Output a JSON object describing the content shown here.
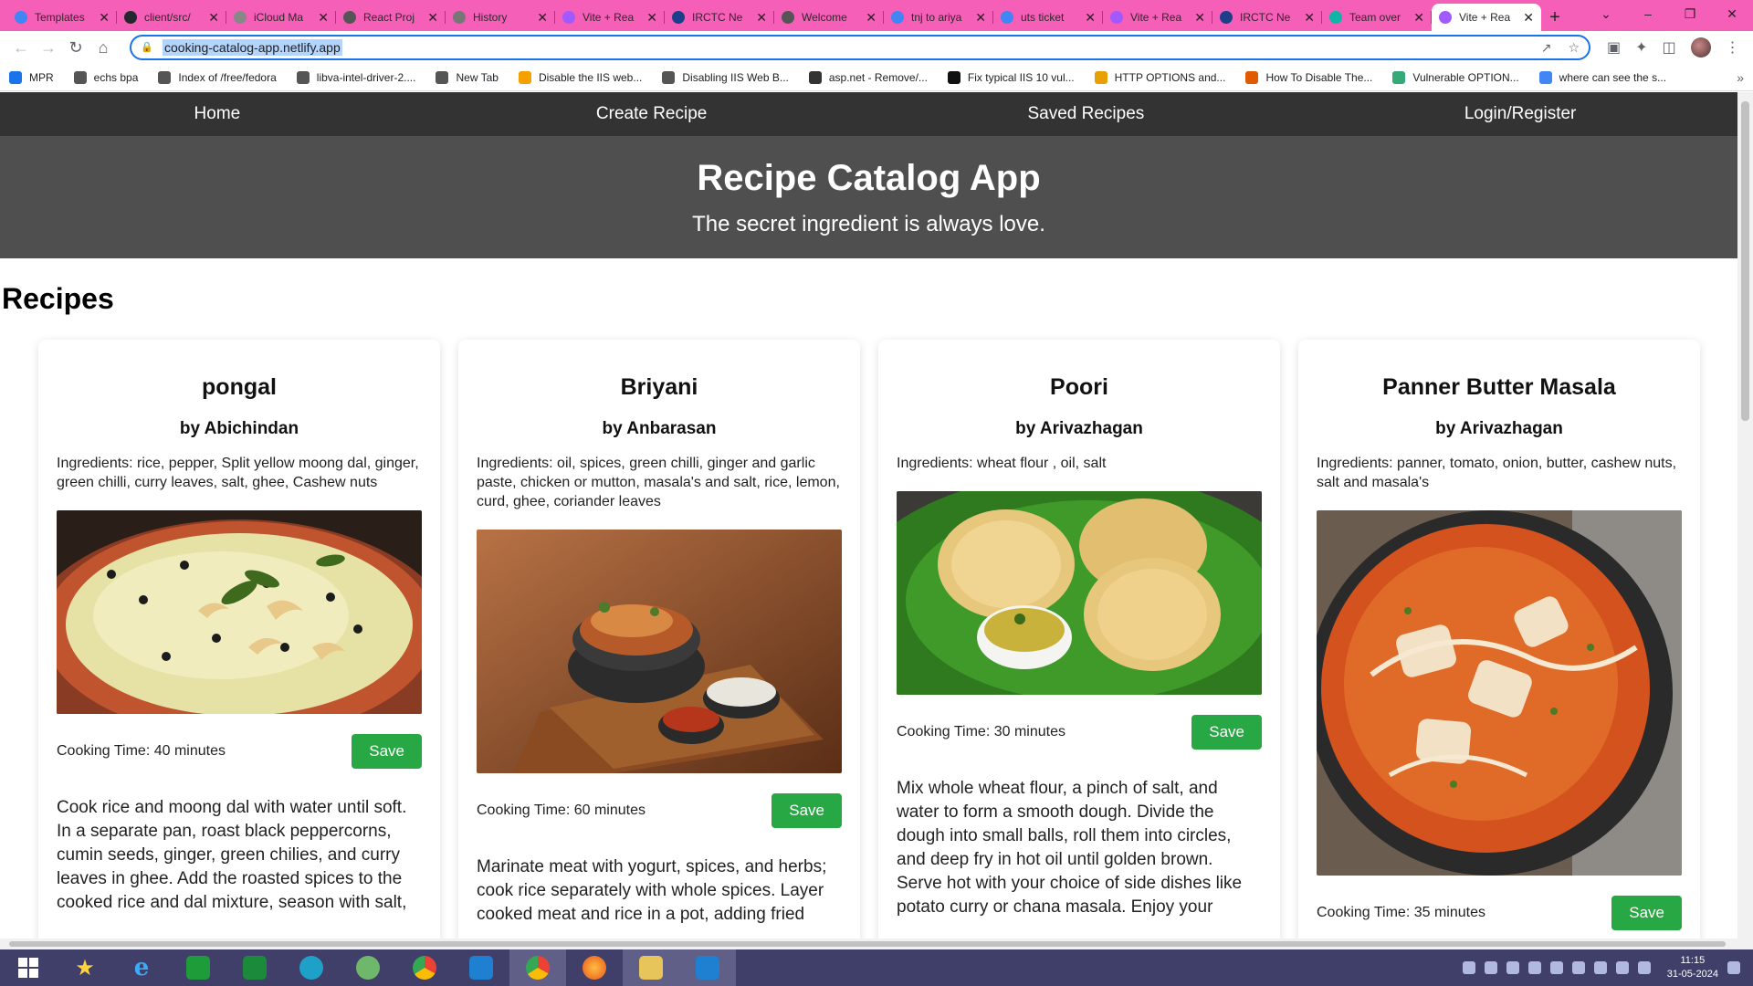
{
  "browser": {
    "tabs": [
      {
        "title": "Templates",
        "color": "#4285f4"
      },
      {
        "title": "client/src/",
        "color": "#24292f"
      },
      {
        "title": "iCloud Ma",
        "color": "#888888"
      },
      {
        "title": "React Proj",
        "color": "#555555"
      },
      {
        "title": "History",
        "color": "#777777"
      },
      {
        "title": "Vite + Rea",
        "color": "#a259ff"
      },
      {
        "title": "IRCTC Ne",
        "color": "#1d3f8a"
      },
      {
        "title": "Welcome",
        "color": "#555555"
      },
      {
        "title": "tnj to ariya",
        "color": "#4285f4"
      },
      {
        "title": "uts ticket",
        "color": "#4285f4"
      },
      {
        "title": "Vite + Rea",
        "color": "#a259ff"
      },
      {
        "title": "IRCTC Ne",
        "color": "#1d3f8a"
      },
      {
        "title": "Team over",
        "color": "#0fb5a6"
      },
      {
        "title": "Vite + Rea",
        "color": "#a259ff",
        "active": true
      }
    ],
    "url": "cooking-catalog-app.netlify.app",
    "bookmarks": [
      {
        "label": "MPR",
        "color": "#1a73e8"
      },
      {
        "label": "echs bpa",
        "color": "#555555"
      },
      {
        "label": "Index of /free/fedora",
        "color": "#555555"
      },
      {
        "label": "libva-intel-driver-2....",
        "color": "#555555"
      },
      {
        "label": "New Tab",
        "color": "#555555"
      },
      {
        "label": "Disable the IIS web...",
        "color": "#f4a100"
      },
      {
        "label": "Disabling IIS Web B...",
        "color": "#555555"
      },
      {
        "label": "asp.net - Remove/...",
        "color": "#333333"
      },
      {
        "label": "Fix typical IIS 10 vul...",
        "color": "#111111"
      },
      {
        "label": "HTTP OPTIONS and...",
        "color": "#e8a000"
      },
      {
        "label": "How To Disable The...",
        "color": "#e05a00"
      },
      {
        "label": "Vulnerable OPTION...",
        "color": "#3a7"
      },
      {
        "label": "where can see the s...",
        "color": "#4285f4"
      }
    ]
  },
  "nav": {
    "home": "Home",
    "create": "Create Recipe",
    "saved": "Saved Recipes",
    "login": "Login/Register"
  },
  "hero": {
    "title": "Recipe Catalog App",
    "tagline": "The secret ingredient is always love."
  },
  "recipes_heading": "Recipes",
  "recipes": [
    {
      "name": "pongal",
      "author": "by Abichindan",
      "ingredients": "Ingredients: rice, pepper, Split yellow moong dal, ginger, green chilli, curry leaves, salt, ghee, Cashew nuts",
      "cooking_time": "Cooking Time: 40 minutes",
      "save": "Save",
      "instructions": "Cook rice and moong dal with water until soft. In a separate pan, roast black peppercorns, cumin seeds, ginger, green chilies, and curry leaves in ghee. Add the roasted spices to the cooked rice and dal mixture, season with salt,"
    },
    {
      "name": "Briyani",
      "author": "by Anbarasan",
      "ingredients": "Ingredients: oil, spices, green chilli, ginger and garlic paste, chicken or mutton, masala's and salt, rice, lemon, curd, ghee, coriander leaves",
      "cooking_time": "Cooking Time: 60 minutes",
      "save": "Save",
      "instructions": "Marinate meat with yogurt, spices, and herbs; cook rice separately with whole spices. Layer cooked meat and rice in a pot, adding fried"
    },
    {
      "name": "Poori",
      "author": "by Arivazhagan",
      "ingredients": "Ingredients: wheat flour , oil, salt",
      "cooking_time": "Cooking Time: 30 minutes",
      "save": "Save",
      "instructions": "Mix whole wheat flour, a pinch of salt, and water to form a smooth dough. Divide the dough into small balls, roll them into circles, and deep fry in hot oil until golden brown. Serve hot with your choice of side dishes like potato curry or chana masala. Enjoy your"
    },
    {
      "name": "Panner Butter Masala",
      "author": "by Arivazhagan",
      "ingredients": "Ingredients: panner, tomato, onion, butter, cashew nuts, salt and masala's",
      "cooking_time": "Cooking Time: 35 minutes",
      "save": "Save",
      "instructions": ""
    }
  ],
  "taskbar": {
    "time": "11:15",
    "date": "31-05-2024"
  },
  "colors": {
    "nav_bg": "#333333",
    "hero_bg": "#4f4f4f",
    "save_button": "#28a745",
    "tab_strip": "#f55fb7",
    "taskbar": "#3f3f6a"
  }
}
